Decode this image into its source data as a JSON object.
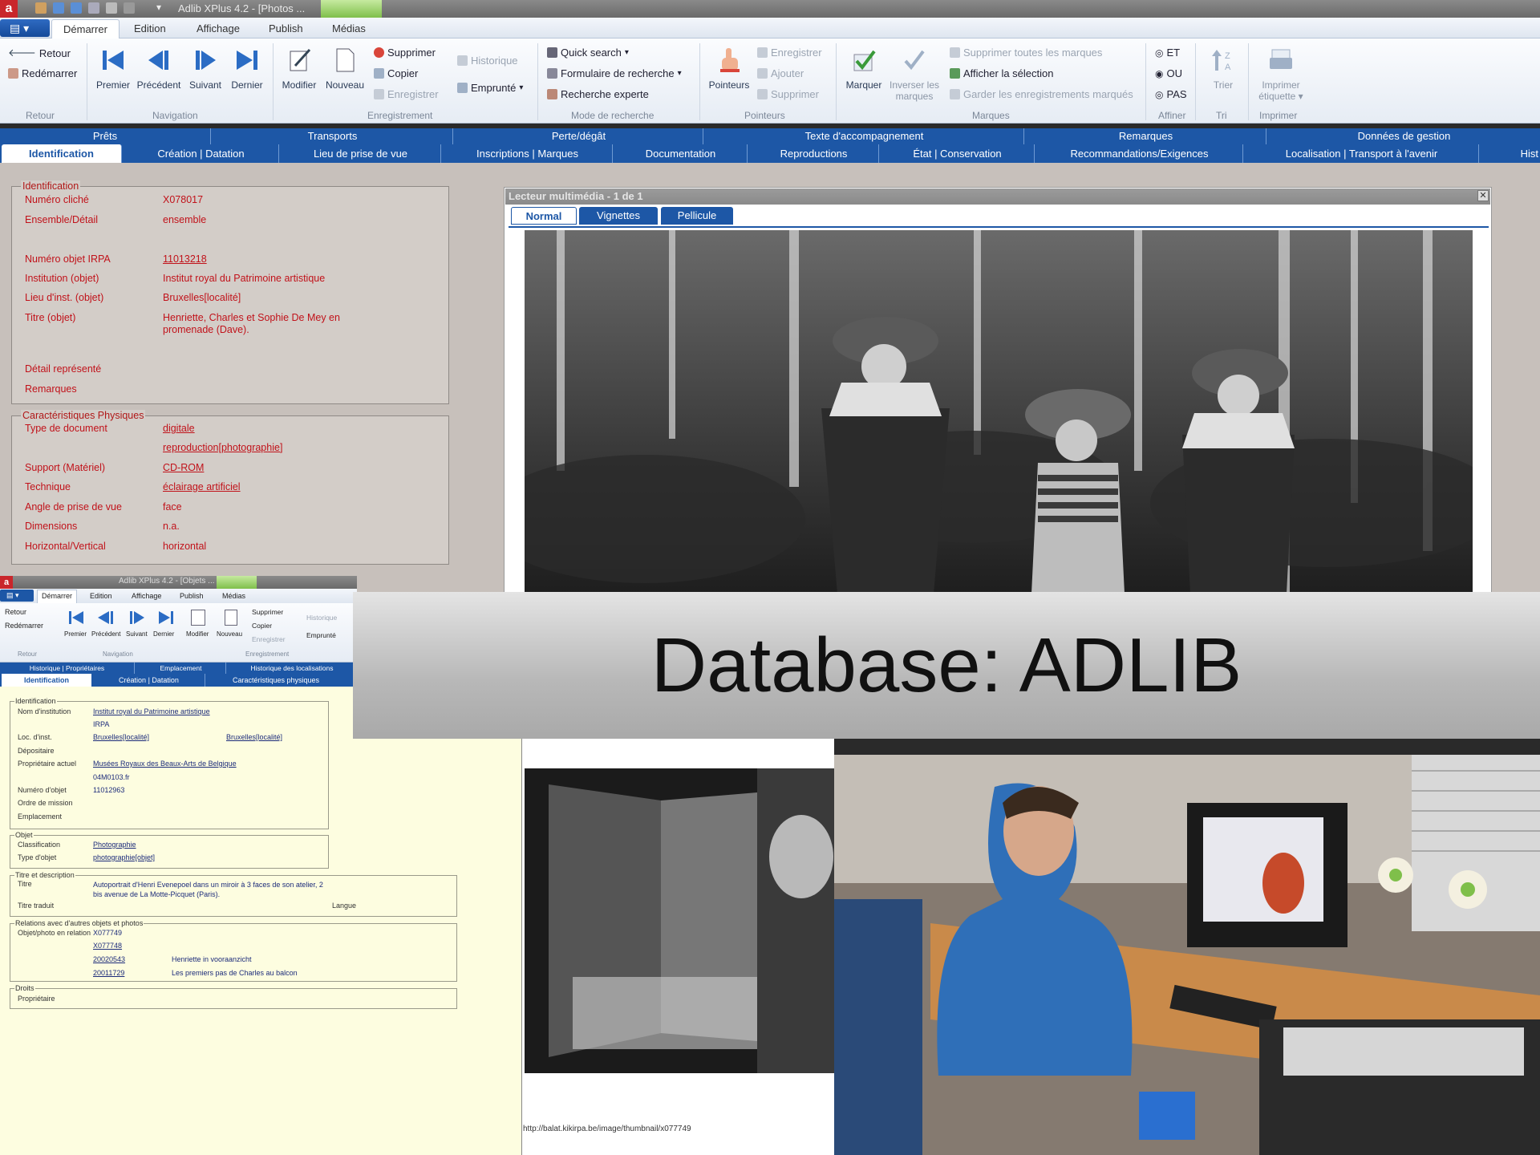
{
  "window": {
    "title": "Adlib XPlus 4.2 - [Photos ...",
    "menu_tabs": [
      "Démarrer",
      "Edition",
      "Affichage",
      "Publish",
      "Médias"
    ]
  },
  "ribbon": {
    "retour": {
      "retour": "Retour",
      "redemarrer": "Redémarrer",
      "label": "Retour"
    },
    "navigation": {
      "premier": "Premier",
      "precedent": "Précédent",
      "suivant": "Suivant",
      "dernier": "Dernier",
      "label": "Navigation"
    },
    "enregistrement": {
      "modifier": "Modifier",
      "nouveau": "Nouveau",
      "supprimer": "Supprimer",
      "copier": "Copier",
      "enregistrer": "Enregistrer",
      "historique": "Historique",
      "emprunte": "Emprunté",
      "label": "Enregistrement"
    },
    "recherche": {
      "quick": "Quick search",
      "formulaire": "Formulaire de recherche",
      "experte": "Recherche experte",
      "label": "Mode de recherche"
    },
    "pointeurs": {
      "pointeurs": "Pointeurs",
      "enregistrer": "Enregistrer",
      "ajouter": "Ajouter",
      "supprimer": "Supprimer",
      "label": "Pointeurs"
    },
    "marques": {
      "marquer": "Marquer",
      "inverser": "Inverser les marques",
      "suppr_toutes": "Supprimer toutes les marques",
      "afficher": "Afficher la sélection",
      "garder": "Garder les enregistrements marqués",
      "label": "Marques"
    },
    "affiner": {
      "et": "ET",
      "ou": "OU",
      "pas": "PAS",
      "label": "Affiner"
    },
    "tri": {
      "trier": "Trier",
      "label": "Tri"
    },
    "imprimer": {
      "etiquette": "Imprimer étiquette",
      "label": "Imprimer"
    }
  },
  "tabs_row1": [
    "Prêts",
    "Transports",
    "Perte/dégât",
    "Texte d'accompagnement",
    "Remarques",
    "Données de gestion"
  ],
  "tabs_row2": [
    "Identification",
    "Création | Datation",
    "Lieu de prise de vue",
    "Inscriptions | Marques",
    "Documentation",
    "Reproductions",
    "État | Conservation",
    "Recommandations/Exigences",
    "Localisation | Transport à l'avenir",
    "Hist"
  ],
  "identification": {
    "legend": "Identification",
    "fields": [
      {
        "label": "Numéro cliché",
        "value": "X078017"
      },
      {
        "label": "Ensemble/Détail",
        "value": "ensemble"
      },
      {
        "label": "Numéro objet IRPA",
        "value": "11013218"
      },
      {
        "label": "Institution (objet)",
        "value": "Institut royal du Patrimoine artistique"
      },
      {
        "label": "Lieu d'inst. (objet)",
        "value": "Bruxelles[localité]"
      },
      {
        "label": "Titre (objet)",
        "value": "Henriette, Charles et Sophie De Mey en promenade (Dave)."
      },
      {
        "label": "Détail représenté",
        "value": ""
      },
      {
        "label": "Remarques",
        "value": ""
      }
    ]
  },
  "physique": {
    "legend": "Caractéristiques Physiques",
    "fields": [
      {
        "label": "Type de document",
        "value": "digitale"
      },
      {
        "label": "",
        "value": "reproduction[photographie]"
      },
      {
        "label": "Support (Matériel)",
        "value": "CD-ROM"
      },
      {
        "label": "Technique",
        "value": "éclairage artificiel"
      },
      {
        "label": "Angle de prise de vue",
        "value": "face"
      },
      {
        "label": "Dimensions",
        "value": "n.a."
      },
      {
        "label": "Horizontal/Vertical",
        "value": "horizontal"
      }
    ]
  },
  "media_viewer": {
    "title": "Lecteur multimédia - 1 de 1",
    "tabs": [
      "Normal",
      "Vignettes",
      "Pellicule"
    ]
  },
  "window2": {
    "title": "Adlib XPlus 4.2 - [Objets ...",
    "menu_tabs": [
      "Démarrer",
      "Edition",
      "Affichage",
      "Publish",
      "Médias"
    ],
    "ribbon": {
      "retour": "Retour",
      "redemarrer": "Redémarrer",
      "premier": "Premier",
      "precedent": "Précédent",
      "suivant": "Suivant",
      "dernier": "Dernier",
      "modifier": "Modifier",
      "nouveau": "Nouveau",
      "supprimer": "Supprimer",
      "copier": "Copier",
      "enregistrer": "Enregistrer",
      "historique": "Historique",
      "emprunte": "Emprunté",
      "g_retour": "Retour",
      "g_navigation": "Navigation",
      "g_enregistrement": "Enregistrement"
    },
    "tabs_row1": [
      "Historique | Propriétaires",
      "Emplacement",
      "Historique des localisations"
    ],
    "tabs_row2": [
      "Identification",
      "Création | Datation",
      "Caractéristiques physiques"
    ],
    "ident": {
      "legend": "Identification",
      "nom_label": "Nom d'institution",
      "nom_value": "Institut royal du Patrimoine artistique",
      "nom_value2": "IRPA",
      "loc_label": "Loc. d'inst.",
      "loc_value": "Bruxelles[localité]",
      "loc_value2": "Bruxelles[localité]",
      "depos_label": "Dépositaire",
      "prop_label": "Propriétaire actuel",
      "prop_value": "Musées Royaux des Beaux-Arts de Belgique",
      "prop_value2": "04M0103.fr",
      "num_label": "Numéro d'objet",
      "num_value": "11012963",
      "ordre_label": "Ordre de mission",
      "empl_label": "Emplacement"
    },
    "objet": {
      "legend": "Objet",
      "class_label": "Classification",
      "class_value": "Photographie",
      "type_label": "Type d'objet",
      "type_value": "photographie[objet]"
    },
    "titre": {
      "legend": "Titre et description",
      "titre_label": "Titre",
      "titre_value": "Autoportrait d'Henri Evenepoel dans un miroir à 3 faces de son atelier, 2 bis avenue de La Motte-Picquet (Paris).",
      "traduit_label": "Titre traduit",
      "langue_label": "Langue"
    },
    "relations": {
      "legend": "Relations avec d'autres objets et photos",
      "label": "Objet/photo en relation",
      "rows": [
        {
          "id": "X077749",
          "text": ""
        },
        {
          "id": "X077748",
          "text": ""
        },
        {
          "id": "20020543",
          "text": "Henriette in vooraanzicht"
        },
        {
          "id": "20011729",
          "text": "Les premiers pas de Charles au balcon"
        }
      ]
    },
    "droits": {
      "legend": "Droits",
      "label": "Propriétaire"
    }
  },
  "banner": {
    "text": "Database: ADLIB"
  },
  "lower_viewer": {
    "url": "http://balat.kikirpa.be/image/thumbnail/x077749"
  },
  "colors": {
    "tab_blue": "#1d57a6",
    "field_red": "#c1121a",
    "form_bg": "#d3cdc8",
    "yellow_form": "#fdfde0"
  }
}
